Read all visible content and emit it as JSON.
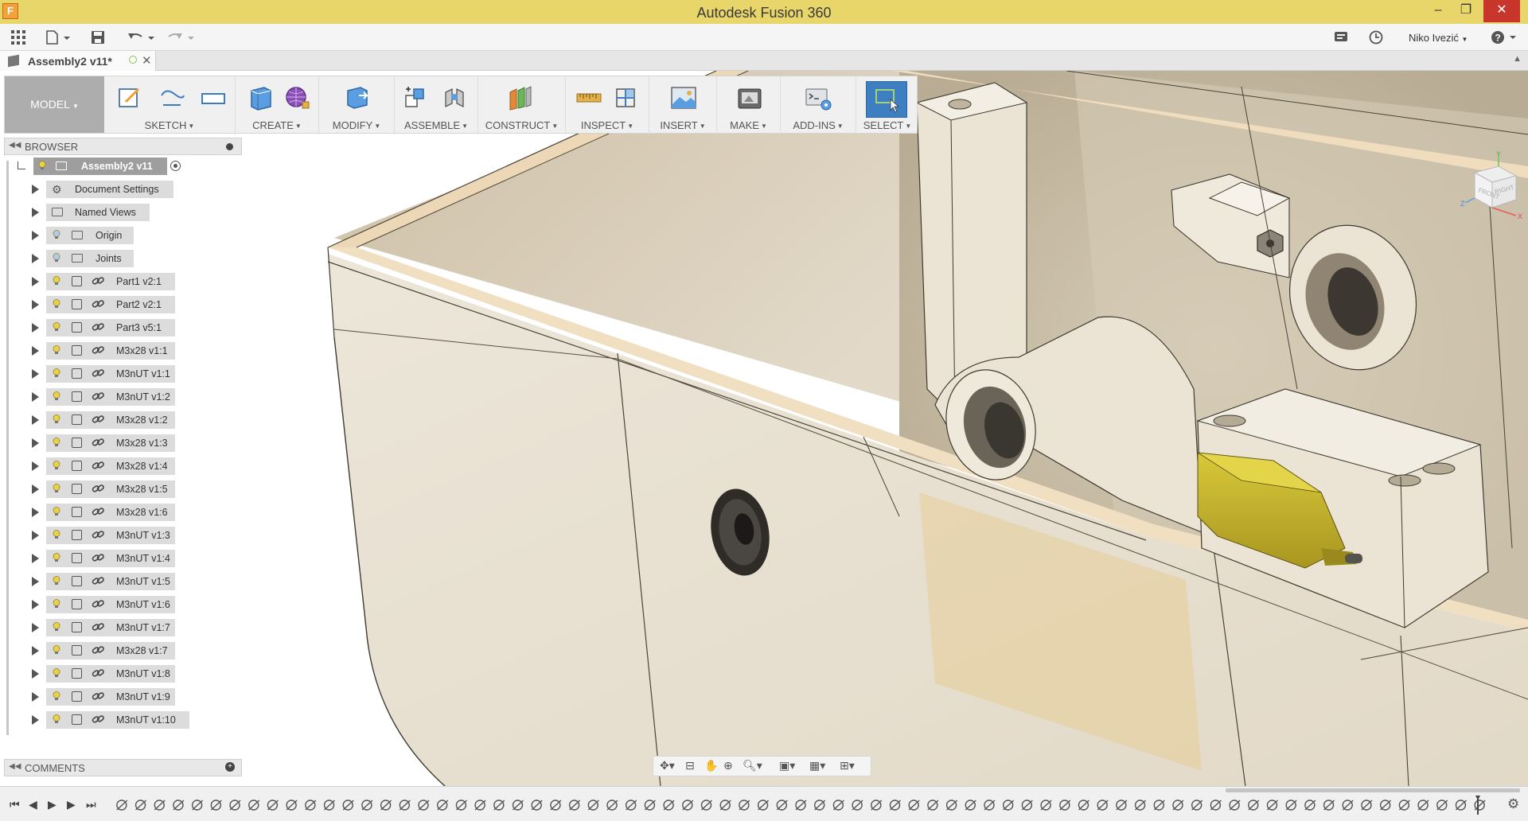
{
  "window": {
    "title": "Autodesk Fusion 360",
    "app_icon": "F",
    "minimize": "–",
    "maximize": "❐",
    "close": "✕"
  },
  "quickbar": {
    "user_name": "Niko Ivezić",
    "icons": [
      "grid-icon",
      "file-icon",
      "save-icon",
      "undo-icon",
      "redo-icon",
      "job-status-icon",
      "history-icon",
      "help-icon"
    ]
  },
  "document_tab": {
    "name": "Assembly2 v11*"
  },
  "ribbon": {
    "workspace": "MODEL",
    "groups": [
      {
        "id": "sketch",
        "label": "SKETCH"
      },
      {
        "id": "create",
        "label": "CREATE"
      },
      {
        "id": "modify",
        "label": "MODIFY"
      },
      {
        "id": "assemble",
        "label": "ASSEMBLE"
      },
      {
        "id": "construct",
        "label": "CONSTRUCT"
      },
      {
        "id": "inspect",
        "label": "INSPECT"
      },
      {
        "id": "insert",
        "label": "INSERT"
      },
      {
        "id": "make",
        "label": "MAKE"
      },
      {
        "id": "addins",
        "label": "ADD-INS"
      },
      {
        "id": "select",
        "label": "SELECT"
      }
    ]
  },
  "browser": {
    "title": "BROWSER",
    "root": "Assembly2 v11",
    "items": [
      {
        "label": "Document Settings",
        "kind": "settings"
      },
      {
        "label": "Named Views",
        "kind": "folder"
      },
      {
        "label": "Origin",
        "kind": "folder-bulb"
      },
      {
        "label": "Joints",
        "kind": "folder-bulb"
      },
      {
        "label": "Part1 v2:1",
        "kind": "link"
      },
      {
        "label": "Part2 v2:1",
        "kind": "link"
      },
      {
        "label": "Part3 v5:1",
        "kind": "link"
      },
      {
        "label": "M3x28 v1:1",
        "kind": "link"
      },
      {
        "label": "M3nUT v1:1",
        "kind": "link"
      },
      {
        "label": "M3nUT v1:2",
        "kind": "link"
      },
      {
        "label": "M3x28 v1:2",
        "kind": "link"
      },
      {
        "label": "M3x28 v1:3",
        "kind": "link"
      },
      {
        "label": "M3x28 v1:4",
        "kind": "link"
      },
      {
        "label": "M3x28 v1:5",
        "kind": "link"
      },
      {
        "label": "M3x28 v1:6",
        "kind": "link"
      },
      {
        "label": "M3nUT v1:3",
        "kind": "link"
      },
      {
        "label": "M3nUT v1:4",
        "kind": "link"
      },
      {
        "label": "M3nUT v1:5",
        "kind": "link"
      },
      {
        "label": "M3nUT v1:6",
        "kind": "link"
      },
      {
        "label": "M3nUT v1:7",
        "kind": "link"
      },
      {
        "label": "M3x28 v1:7",
        "kind": "link"
      },
      {
        "label": "M3nUT v1:8",
        "kind": "link"
      },
      {
        "label": "M3nUT v1:9",
        "kind": "link"
      },
      {
        "label": "M3nUT v1:10",
        "kind": "link"
      }
    ]
  },
  "comments": {
    "title": "COMMENTS"
  },
  "viewcube": {
    "front": "FRONT",
    "right": "RIGHT",
    "x": "X",
    "y": "Y",
    "z": "Z"
  },
  "timeline": {
    "feature_count": 73
  },
  "colors": {
    "titlebar": "#e9d66a",
    "model_body": "#e8e0d0",
    "accent_select": "#3d7fc1",
    "part_yellow": "#c9b82a"
  }
}
